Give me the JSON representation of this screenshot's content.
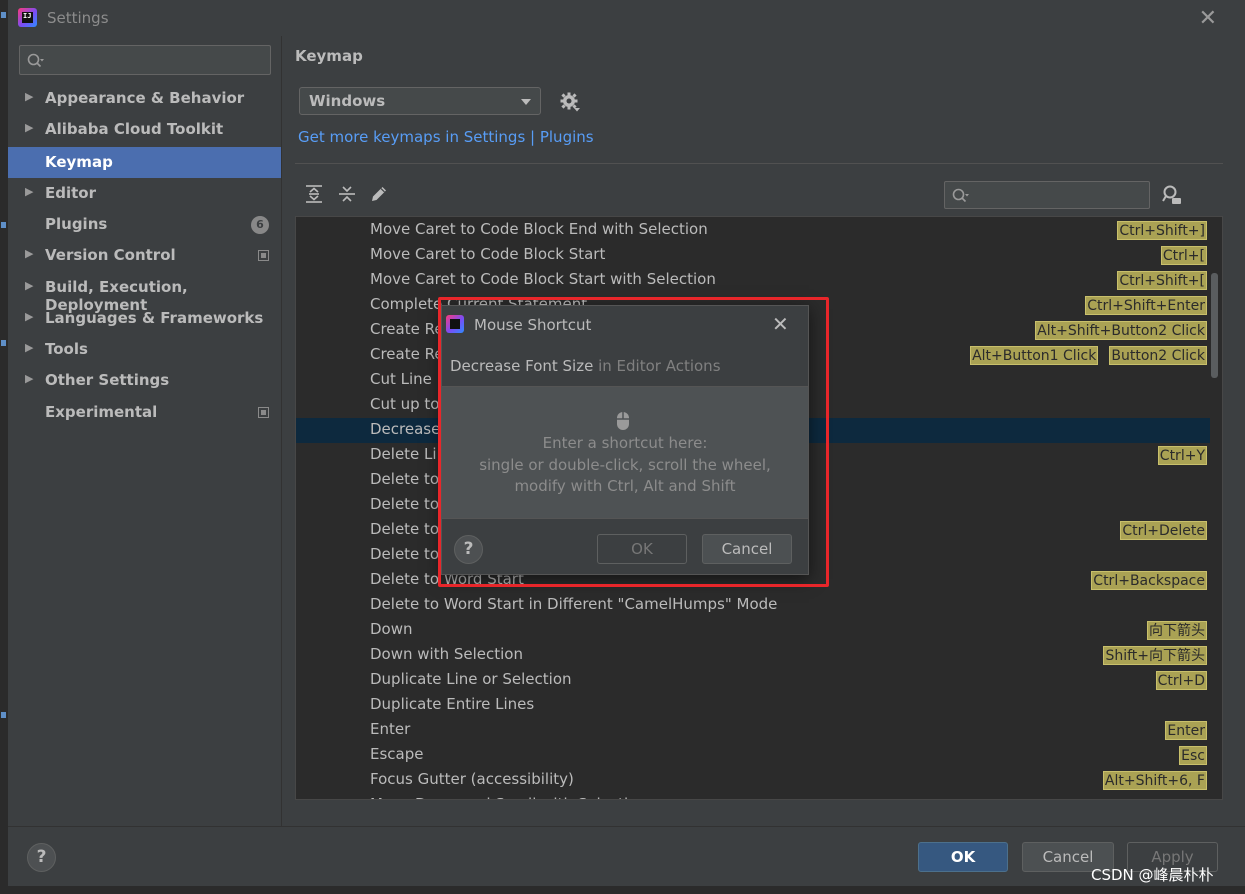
{
  "window": {
    "title": "Settings"
  },
  "sidebar": {
    "search_placeholder": "",
    "items": [
      {
        "label": "Appearance & Behavior",
        "expandable": true
      },
      {
        "label": "Alibaba Cloud Toolkit",
        "expandable": true
      },
      {
        "label": "Keymap",
        "selected": true
      },
      {
        "label": "Editor",
        "expandable": true
      },
      {
        "label": "Plugins",
        "badge": "6"
      },
      {
        "label": "Version Control",
        "expandable": true,
        "project_icon": true
      },
      {
        "label": "Build, Execution, Deployment",
        "expandable": true
      },
      {
        "label": "Languages & Frameworks",
        "expandable": true
      },
      {
        "label": "Tools",
        "expandable": true
      },
      {
        "label": "Other Settings",
        "expandable": true
      },
      {
        "label": "Experimental",
        "project_icon": true
      }
    ]
  },
  "keymap": {
    "title": "Keymap",
    "scheme": "Windows",
    "link": "Get more keymaps in Settings | Plugins",
    "filter_placeholder": "",
    "actions": [
      {
        "name": "Move Caret to Code Block End with Selection",
        "shortcuts": [
          "Ctrl+Shift+]"
        ]
      },
      {
        "name": "Move Caret to Code Block Start",
        "shortcuts": [
          "Ctrl+["
        ]
      },
      {
        "name": "Move Caret to Code Block Start with Selection",
        "shortcuts": [
          "Ctrl+Shift+["
        ]
      },
      {
        "name": "Complete Current Statement",
        "shortcuts": [
          "Ctrl+Shift+Enter"
        ]
      },
      {
        "name": "Create Rectangular Selection",
        "shortcuts": [
          "Alt+Shift+Button2 Click"
        ]
      },
      {
        "name": "Create Rectangular Selection on Mouse Drag",
        "shortcuts": [
          "Alt+Button1 Click",
          "Button2 Click"
        ]
      },
      {
        "name": "Cut Line",
        "shortcuts": []
      },
      {
        "name": "Cut up to Line End",
        "shortcuts": []
      },
      {
        "name": "Decrease Font Size",
        "shortcuts": [],
        "selected": true
      },
      {
        "name": "Delete Line",
        "shortcuts": [
          "Ctrl+Y"
        ]
      },
      {
        "name": "Delete to Line End",
        "shortcuts": []
      },
      {
        "name": "Delete to Line Start",
        "shortcuts": []
      },
      {
        "name": "Delete to Word End",
        "shortcuts": [
          "Ctrl+Delete"
        ]
      },
      {
        "name": "Delete to Word End in Different \"CamelHumps\" Mode",
        "shortcuts": []
      },
      {
        "name": "Delete to Word Start",
        "shortcuts": [
          "Ctrl+Backspace"
        ]
      },
      {
        "name": "Delete to Word Start in Different \"CamelHumps\" Mode",
        "shortcuts": []
      },
      {
        "name": "Down",
        "shortcuts": [
          "向下箭头"
        ]
      },
      {
        "name": "Down with Selection",
        "shortcuts": [
          "Shift+向下箭头"
        ]
      },
      {
        "name": "Duplicate Line or Selection",
        "shortcuts": [
          "Ctrl+D"
        ]
      },
      {
        "name": "Duplicate Entire Lines",
        "shortcuts": []
      },
      {
        "name": "Enter",
        "shortcuts": [
          "Enter"
        ]
      },
      {
        "name": "Escape",
        "shortcuts": [
          "Esc"
        ]
      },
      {
        "name": "Focus Gutter (accessibility)",
        "shortcuts": [
          "Alt+Shift+6, F"
        ]
      },
      {
        "name": "Move Down and Scroll with Selection",
        "shortcuts": []
      }
    ]
  },
  "dialog": {
    "title": "Mouse Shortcut",
    "action_name": "Decrease Font Size",
    "action_context": "in Editor Actions",
    "hint_line1": "Enter a shortcut here:",
    "hint_line2": "single or double-click, scroll the wheel,",
    "hint_line3": "modify with Ctrl, Alt and Shift",
    "help": "?",
    "ok_label": "OK",
    "cancel_label": "Cancel"
  },
  "footer": {
    "help": "?",
    "ok_label": "OK",
    "cancel_label": "Cancel",
    "apply_label": "Apply"
  },
  "watermark": "CSDN @峰晨朴朴",
  "colors": {
    "background": "#3c3f41",
    "selection": "#4b6eaf",
    "shortcut_badge": "#aaa254",
    "link": "#589df6",
    "highlight_border": "#e8262a"
  }
}
